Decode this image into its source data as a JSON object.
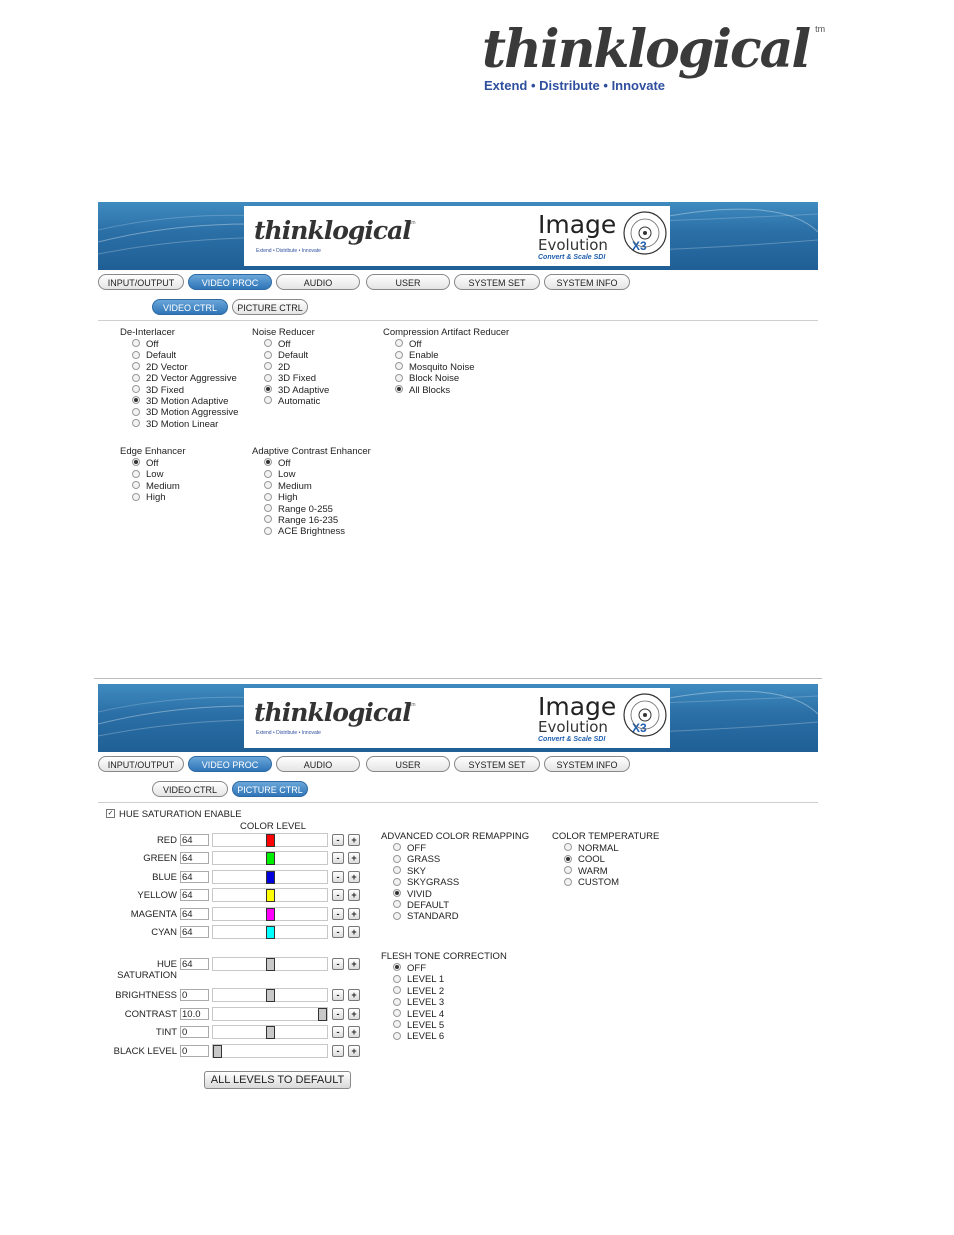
{
  "page_logo": {
    "word": "thinklogical",
    "tm": "tm",
    "tagline": "Extend • Distribute • Innovate"
  },
  "banner": {
    "logo_word": "thinklogical",
    "logo_tm": "tm",
    "logo_tagline": "Extend • Distribute • Innovate",
    "product_title": "Image",
    "product_subtitle": "Evolution",
    "product_suffix": "X3",
    "product_caption": "Convert & Scale SDI"
  },
  "tabs": [
    "INPUT/OUTPUT",
    "VIDEO PROC",
    "AUDIO",
    "USER",
    "SYSTEM SET",
    "SYSTEM INFO"
  ],
  "active_tab": "VIDEO PROC",
  "subtabs": [
    "VIDEO CTRL",
    "PICTURE CTRL"
  ],
  "video_ctrl": {
    "deinterlacer": {
      "title": "De-Interlacer",
      "options": [
        "Off",
        "Default",
        "2D Vector",
        "2D Vector Aggressive",
        "3D Fixed",
        "3D Motion Adaptive",
        "3D Motion Aggressive",
        "3D Motion Linear"
      ],
      "selected": 5
    },
    "noise_reducer": {
      "title": "Noise Reducer",
      "options": [
        "Off",
        "Default",
        "2D",
        "3D Fixed",
        "3D Adaptive",
        "Automatic"
      ],
      "selected": 4
    },
    "compression": {
      "title": "Compression Artifact Reducer",
      "options": [
        "Off",
        "Enable",
        "Mosquito Noise",
        "Block Noise",
        "All Blocks"
      ],
      "selected": 4
    },
    "edge_enhancer": {
      "title": "Edge Enhancer",
      "options": [
        "Off",
        "Low",
        "Medium",
        "High"
      ],
      "selected": 0
    },
    "ace": {
      "title": "Adaptive Contrast Enhancer",
      "options": [
        "Off",
        "Low",
        "Medium",
        "High",
        "Range 0-255",
        "Range 16-235",
        "ACE Brightness"
      ],
      "selected": 0
    }
  },
  "picture_ctrl": {
    "hue_enable_label": "HUE SATURATION ENABLE",
    "hue_enable_checked": true,
    "color_level_label": "COLOR LEVEL",
    "minus": "-",
    "plus": "+",
    "color_sliders": [
      {
        "label": "RED",
        "value": "64",
        "color": "#ff0000",
        "fraction": 0.5
      },
      {
        "label": "GREEN",
        "value": "64",
        "color": "#00ee00",
        "fraction": 0.5
      },
      {
        "label": "BLUE",
        "value": "64",
        "color": "#0000dd",
        "fraction": 0.5
      },
      {
        "label": "YELLOW",
        "value": "64",
        "color": "#ffff00",
        "fraction": 0.5
      },
      {
        "label": "MAGENTA",
        "value": "64",
        "color": "#ff00ff",
        "fraction": 0.5
      },
      {
        "label": "CYAN",
        "value": "64",
        "color": "#00ffff",
        "fraction": 0.5
      }
    ],
    "hue_saturation": {
      "label": "HUE SATURATION",
      "value": "64",
      "color": "#c8c8c8",
      "fraction": 0.5
    },
    "level_sliders": [
      {
        "label": "BRIGHTNESS",
        "value": "0",
        "color": "#c8c8c8",
        "fraction": 0.5
      },
      {
        "label": "CONTRAST",
        "value": "10.0",
        "color": "#c8c8c8",
        "fraction": 1.0
      },
      {
        "label": "TINT",
        "value": "0",
        "color": "#c8c8c8",
        "fraction": 0.5
      },
      {
        "label": "BLACK LEVEL",
        "value": "0",
        "color": "#c8c8c8",
        "fraction": 0.0
      }
    ],
    "default_button": "ALL LEVELS TO DEFAULT",
    "remapping": {
      "title": "ADVANCED COLOR REMAPPING",
      "options": [
        "OFF",
        "GRASS",
        "SKY",
        "SKYGRASS",
        "VIVID",
        "DEFAULT",
        "STANDARD"
      ],
      "selected": 4
    },
    "color_temp": {
      "title": "COLOR TEMPERATURE",
      "options": [
        "NORMAL",
        "COOL",
        "WARM",
        "CUSTOM"
      ],
      "selected": 1
    },
    "flesh_tone": {
      "title": "FLESH TONE CORRECTION",
      "options": [
        "OFF",
        "LEVEL 1",
        "LEVEL 2",
        "LEVEL 3",
        "LEVEL 4",
        "LEVEL 5",
        "LEVEL 6"
      ],
      "selected": 0
    }
  }
}
